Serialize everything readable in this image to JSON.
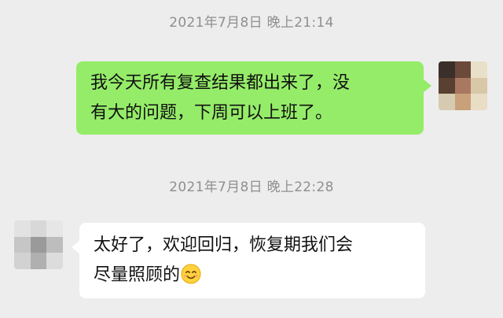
{
  "chat": {
    "timestamps": [
      "2021年7月8日 晚上21:14",
      "2021年7月8日 晚上22:28"
    ],
    "messages": [
      {
        "sender": "self",
        "lines": [
          "我今天所有复查结果都出来了，没",
          "有大的问题，下周可以上班了。"
        ],
        "bubble_color": "#95ec69"
      },
      {
        "sender": "other",
        "lines": [
          "太好了，欢迎回归，恢复期我们会",
          "尽量照顾的"
        ],
        "emoji": "smiling-face-icon",
        "bubble_color": "#ffffff"
      }
    ]
  },
  "avatars": {
    "self": {
      "icon": "blurred-avatar-icon",
      "colors": [
        "#3a2f2a",
        "#6b4a3a",
        "#e8e0c8",
        "#5a4030",
        "#a97860",
        "#d8c8a8",
        "#d6cbb0",
        "#c8a07a",
        "#e9ddc6"
      ]
    },
    "other": {
      "icon": "blurred-avatar-icon",
      "colors": [
        "#e2e2e2",
        "#d8d8d8",
        "#e6e6e6",
        "#c6c6c6",
        "#9a9a9a",
        "#bdbdbd",
        "#d2d2d2",
        "#b0b0b0",
        "#dcdcdc"
      ]
    }
  },
  "colors": {
    "background": "#ededed",
    "timestamp_text": "#8f8f8f",
    "sent_bubble": "#95ec69",
    "received_bubble": "#ffffff"
  }
}
